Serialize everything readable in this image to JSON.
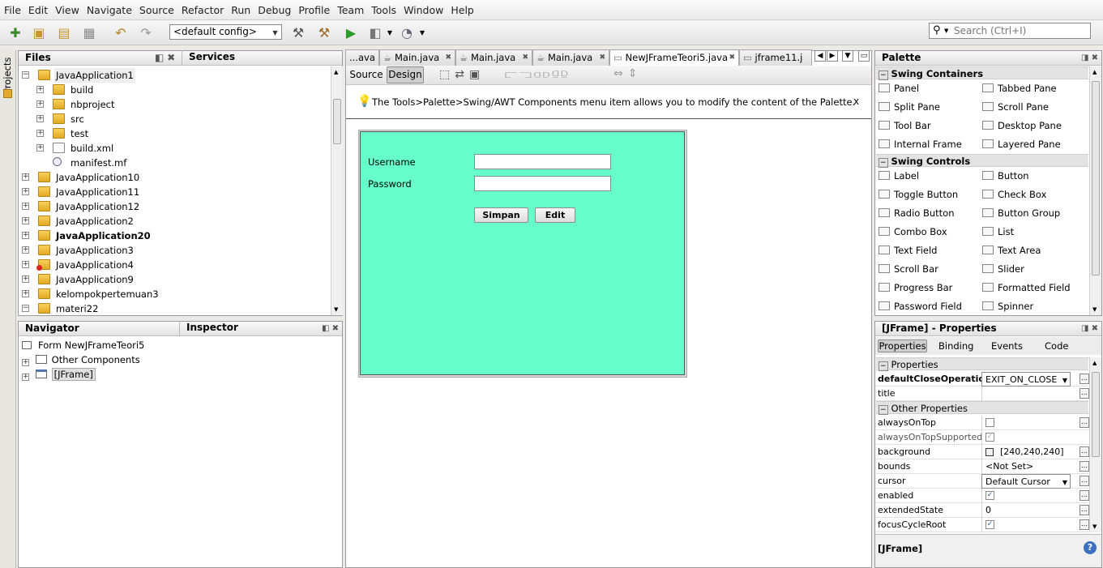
{
  "menu": [
    "File",
    "Edit",
    "View",
    "Navigate",
    "Source",
    "Refactor",
    "Run",
    "Debug",
    "Profile",
    "Team",
    "Tools",
    "Window",
    "Help"
  ],
  "toolbar": {
    "config": "<default config>",
    "search_placeholder": "Search (Ctrl+I)"
  },
  "side_tab": "Projects",
  "files_panel": {
    "title": "Files",
    "services": "Services",
    "tree": [
      "JavaApplication1",
      "build",
      "nbproject",
      "src",
      "test",
      "build.xml",
      "manifest.mf",
      "JavaApplication10",
      "JavaApplication11",
      "JavaApplication12",
      "JavaApplication2",
      "JavaApplication20",
      "JavaApplication3",
      "JavaApplication4",
      "JavaApplication9",
      "kelompokpertemuan3",
      "materi22"
    ]
  },
  "navigator": {
    "title": "Navigator",
    "inspector": "Inspector",
    "tree": [
      "Form NewJFrameTeori5",
      "Other Components",
      "[JFrame]"
    ]
  },
  "editor": {
    "tabs": [
      "...ava",
      "Main.java",
      "Main.java",
      "Main.java",
      "NewJFrameTeori5.java",
      "jframe11.j"
    ],
    "source_btn": "Source",
    "design_btn": "Design",
    "hint": "The Tools>Palette>Swing/AWT Components menu item allows you to modify the content of the Palette.",
    "hint_close": "x",
    "form": {
      "bg": "#66ffcc",
      "username_label": "Username",
      "password_label": "Password",
      "save_btn": "Simpan",
      "edit_btn": "Edit"
    }
  },
  "palette": {
    "title": "Palette",
    "containers_title": "Swing Containers",
    "containers": [
      "Panel",
      "Tabbed Pane",
      "Split Pane",
      "Scroll Pane",
      "Tool Bar",
      "Desktop Pane",
      "Internal Frame",
      "Layered Pane"
    ],
    "controls_title": "Swing Controls",
    "controls": [
      "Label",
      "Button",
      "Toggle Button",
      "Check Box",
      "Radio Button",
      "Button Group",
      "Combo Box",
      "List",
      "Text Field",
      "Text Area",
      "Scroll Bar",
      "Slider",
      "Progress Bar",
      "Formatted Field",
      "Password Field",
      "Spinner"
    ]
  },
  "properties": {
    "title": "[JFrame] - Properties",
    "tabs": [
      "Properties",
      "Binding",
      "Events",
      "Code"
    ],
    "section1": "Properties",
    "section2": "Other Properties",
    "rows": [
      {
        "name": "defaultCloseOperation",
        "value": "EXIT_ON_CLOSE"
      },
      {
        "name": "title",
        "value": ""
      },
      {
        "name": "alwaysOnTop",
        "value": ""
      },
      {
        "name": "alwaysOnTopSupported",
        "value": ""
      },
      {
        "name": "background",
        "value": "[240,240,240]"
      },
      {
        "name": "bounds",
        "value": "<Not Set>"
      },
      {
        "name": "cursor",
        "value": "Default Cursor"
      },
      {
        "name": "enabled",
        "value": ""
      },
      {
        "name": "extendedState",
        "value": "0"
      },
      {
        "name": "focusCycleRoot",
        "value": ""
      }
    ],
    "footer": "[JFrame]"
  }
}
